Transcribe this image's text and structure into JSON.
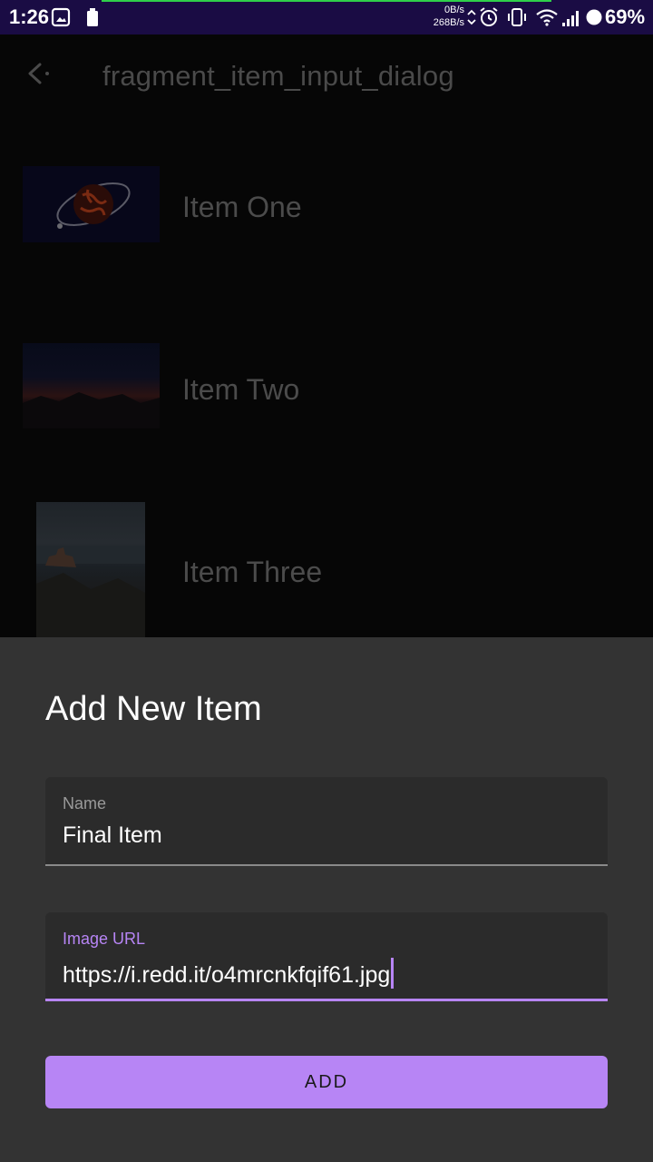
{
  "status_bar": {
    "time": "1:26",
    "speed_up": "0B/s",
    "speed_down": "268B/s",
    "battery": "69%"
  },
  "app_bar": {
    "title": "fragment_item_input_dialog"
  },
  "list": {
    "items": [
      {
        "label": "Item One",
        "thumbnail": "planet-orbit-image"
      },
      {
        "label": "Item Two",
        "thumbnail": "sunset-mountains-image"
      },
      {
        "label": "Item Three",
        "thumbnail": "coastal-church-image"
      }
    ]
  },
  "dialog": {
    "title": "Add New Item",
    "name_field": {
      "label": "Name",
      "value": "Final Item"
    },
    "url_field": {
      "label": "Image URL",
      "value": "https://i.redd.it/o4mrcnkfqif61.jpg"
    },
    "add_label": "ADD"
  },
  "colors": {
    "accent": "#b785f5",
    "status_bar": "#1a0c44",
    "sheet": "#333333",
    "field": "#2b2b2b"
  }
}
